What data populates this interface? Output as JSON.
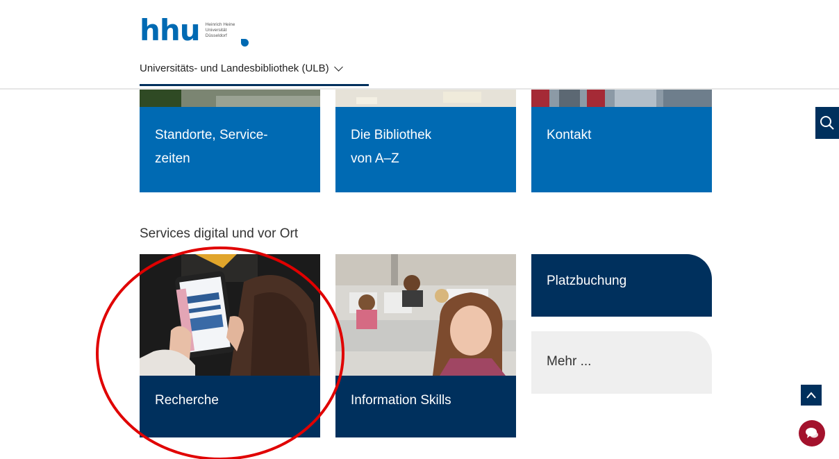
{
  "header": {
    "logo_text": "hhu",
    "logo_sub_line1": "Heinrich Heine",
    "logo_sub_line2": "Universität",
    "logo_sub_line3": "Düsseldorf",
    "nav_label": "Universitäts- und Landesbibliothek (ULB)"
  },
  "top_tiles": [
    {
      "line1": "Standorte, Service-",
      "line2": "zeiten"
    },
    {
      "line1": "Die Bibliothek",
      "line2": "von A–Z"
    },
    {
      "line1": "Kontakt",
      "line2": ""
    }
  ],
  "services": {
    "title": "Services digital und vor Ort",
    "cards": [
      {
        "label": "Recherche"
      },
      {
        "label": "Information Skills"
      }
    ],
    "links": [
      {
        "label": "Platzbuchung"
      },
      {
        "label": "Mehr ..."
      }
    ]
  },
  "colors": {
    "brand_blue": "#006ab3",
    "navy": "#00305d",
    "chat_red": "#a3122c",
    "annotation_red": "#e00000"
  },
  "icons": {
    "search": "search-icon",
    "back_to_top": "chevron-up-icon",
    "chat": "chat-icon"
  }
}
